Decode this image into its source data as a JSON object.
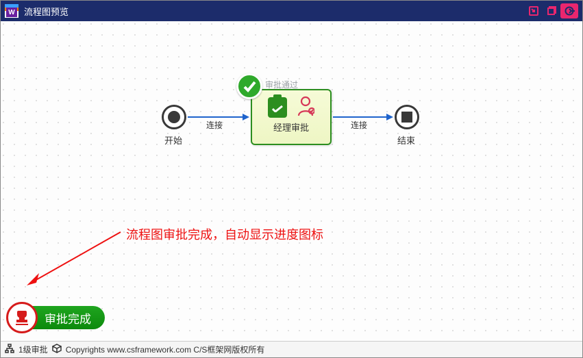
{
  "window": {
    "title": "流程图预览",
    "logo_letter": "W"
  },
  "nodes": {
    "start_label": "开始",
    "end_label": "结束",
    "task_label": "经理审批",
    "task_badge_label": "审批通过"
  },
  "edges": {
    "e1_label": "连接",
    "e2_label": "连接"
  },
  "annotation": {
    "text": "流程图审批完成，自动显示进度图标"
  },
  "stamp": {
    "text": "审批完成"
  },
  "statusbar": {
    "level": "1级审批",
    "copyright": "Copyrights www.csframework.com C/S框架网版权所有"
  }
}
